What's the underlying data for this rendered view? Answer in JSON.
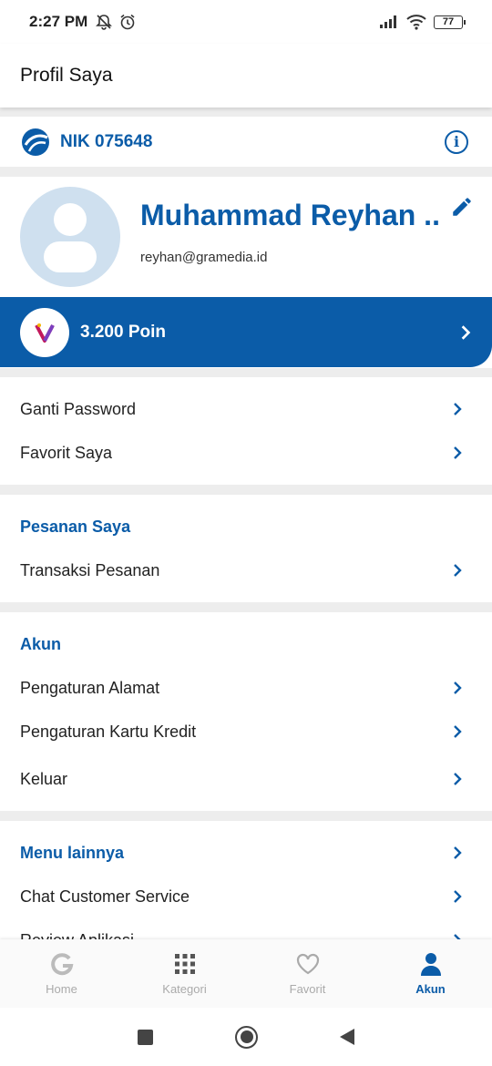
{
  "status_bar": {
    "time": "2:27 PM",
    "battery": "77"
  },
  "app_bar": {
    "title": "Profil Saya"
  },
  "nik": {
    "label": "NIK 075648"
  },
  "profile": {
    "name": "Muhammad Reyhan ...",
    "email": "reyhan@gramedia.id"
  },
  "points": {
    "label": "3.200 Poin"
  },
  "section_account_quick": {
    "items": [
      {
        "label": "Ganti Password"
      },
      {
        "label": "Favorit Saya"
      }
    ]
  },
  "section_orders": {
    "title": "Pesanan Saya",
    "items": [
      {
        "label": "Transaksi Pesanan"
      }
    ]
  },
  "section_account": {
    "title": "Akun",
    "items": [
      {
        "label": "Pengaturan Alamat"
      },
      {
        "label": "Pengaturan Kartu Kredit"
      },
      {
        "label": "Keluar"
      }
    ]
  },
  "section_more": {
    "title": "Menu lainnya",
    "items": [
      {
        "label": "Chat Customer Service"
      },
      {
        "label": "Review Aplikasi"
      }
    ]
  },
  "bottom_nav": {
    "items": [
      {
        "label": "Home",
        "icon": "gramedia-g-icon"
      },
      {
        "label": "Kategori",
        "icon": "grid-icon"
      },
      {
        "label": "Favorit",
        "icon": "heart-icon"
      },
      {
        "label": "Akun",
        "icon": "user-icon"
      }
    ],
    "active": "Akun"
  },
  "colors": {
    "primary": "#0b5ca8",
    "background": "#ededed"
  }
}
